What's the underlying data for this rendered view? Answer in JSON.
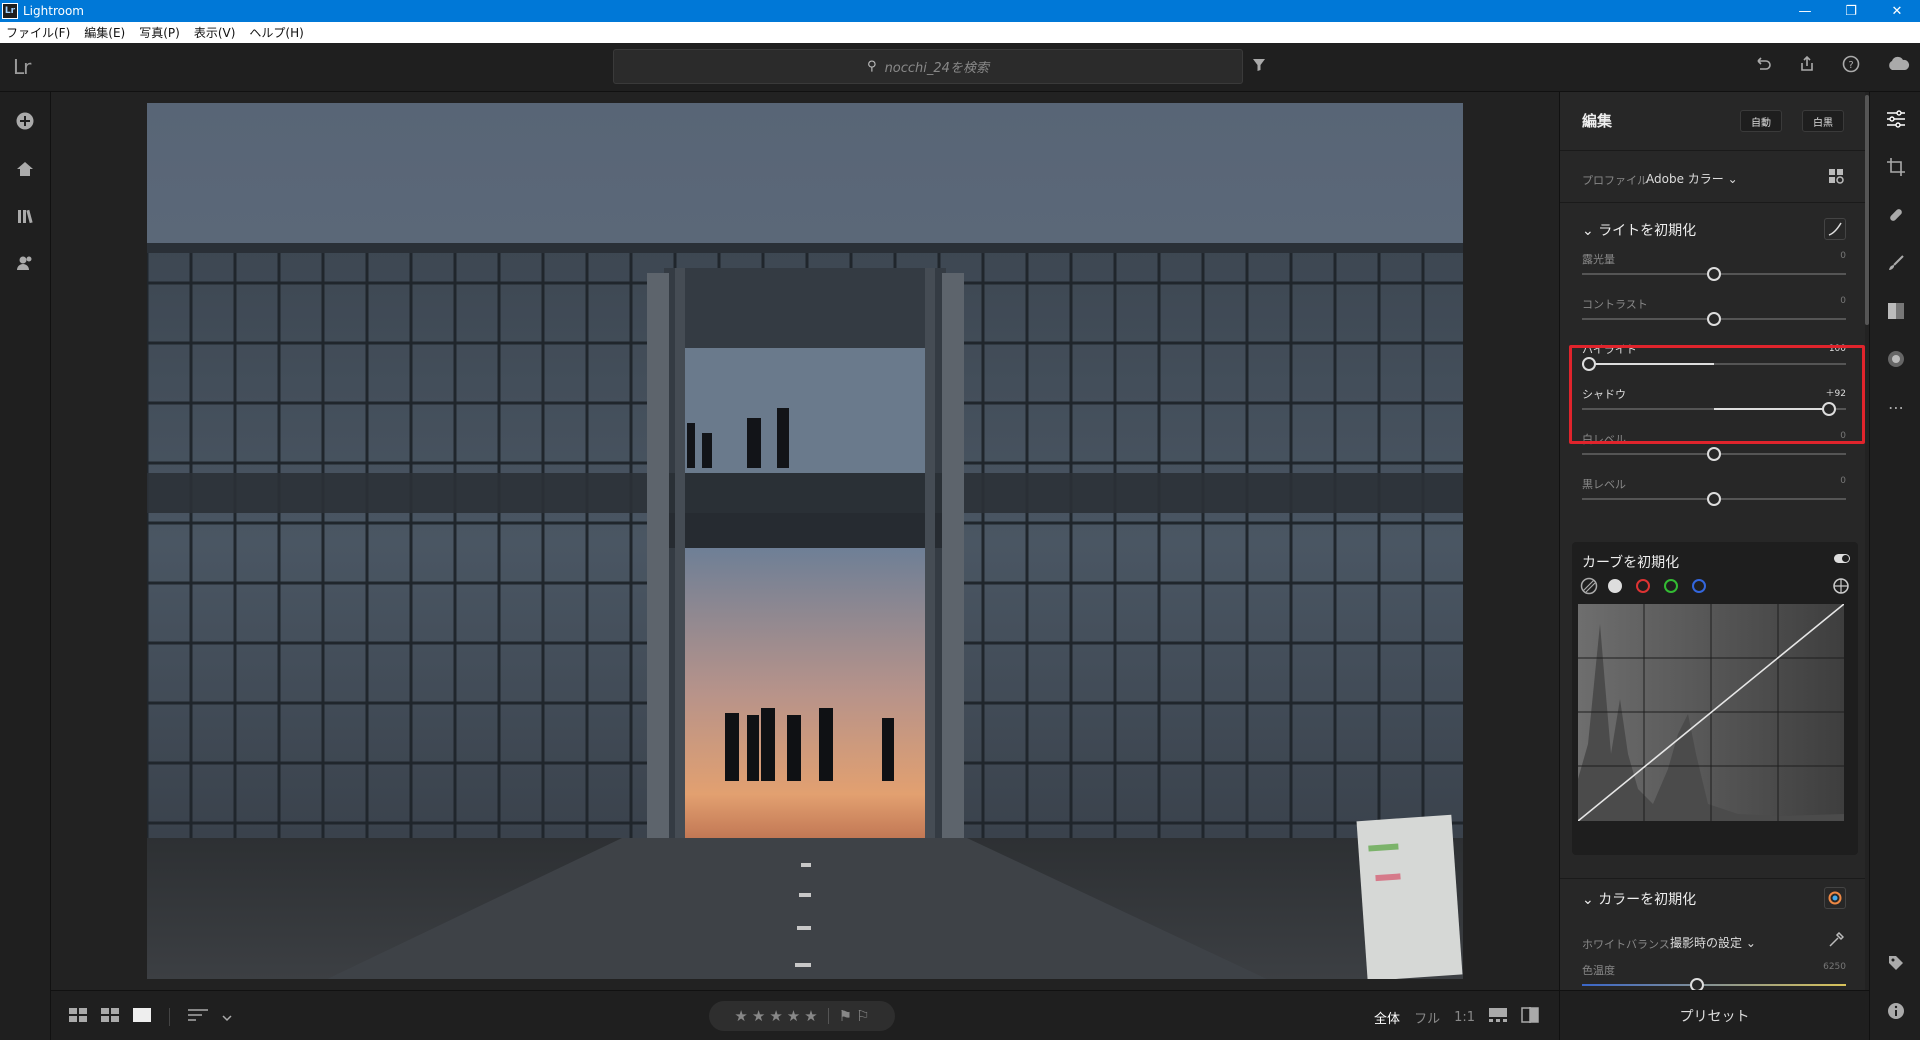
{
  "window": {
    "title": "Lightroom",
    "badge": "Lr",
    "controls": [
      "—",
      "❐",
      "✕"
    ]
  },
  "menu": [
    "ファイル(F)",
    "編集(E)",
    "写真(P)",
    "表示(V)",
    "ヘルプ(H)"
  ],
  "header": {
    "logo": "Lr",
    "search_placeholder": "nocchi_24を検索",
    "icons": [
      "undo-icon",
      "share-icon",
      "help-icon",
      "cloud-icon"
    ]
  },
  "left_rail": [
    "add-photos-icon",
    "home-icon",
    "library-icon",
    "people-icon"
  ],
  "edit_panel": {
    "title": "編集",
    "auto_button": "自動",
    "bw_button": "白黒",
    "profile_label": "プロファイル",
    "profile_value": "Adobe カラー",
    "light_section": "ライトを初期化",
    "sliders": [
      {
        "label": "露光量",
        "value": "0",
        "pos": 0.5
      },
      {
        "label": "コントラスト",
        "value": "0",
        "pos": 0.5
      },
      {
        "label": "ハイライト",
        "value": "－100",
        "pos": 0.0
      },
      {
        "label": "シャドウ",
        "value": "＋92",
        "pos": 0.96
      },
      {
        "label": "白レベル",
        "value": "0",
        "pos": 0.5
      },
      {
        "label": "黒レベル",
        "value": "0",
        "pos": 0.5
      }
    ],
    "curve_section": "カーブを初期化",
    "color_section": "カラーを初期化",
    "wb_label": "ホワイトバランス",
    "wb_value": "撮影時の設定",
    "temp_label": "色温度",
    "temp_value": "6250",
    "temp_pos": 0.43,
    "presets": "プリセット"
  },
  "bottom": {
    "stars": [
      "★",
      "★",
      "★",
      "★",
      "★"
    ],
    "flags": [
      "⚑",
      "⚐"
    ],
    "zoom": [
      "全体",
      "フル",
      "1:1"
    ]
  },
  "right_rail": [
    "edit-icon",
    "crop-icon",
    "healing-icon",
    "brush-icon",
    "linear-gradient-icon",
    "radial-gradient-icon",
    "more-icon",
    "tag-icon",
    "info-icon"
  ],
  "colors": {
    "accent_red": "#e0242c",
    "titlebar": "#0078d7"
  }
}
